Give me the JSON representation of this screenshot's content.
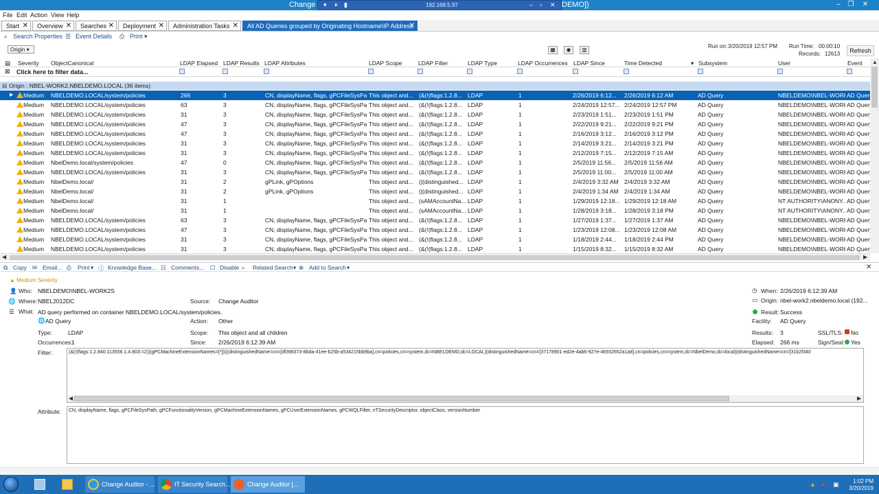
{
  "window": {
    "title": "Change",
    "title_tail": "DEMO])",
    "rdp_ip": "192.168.5.97"
  },
  "menu": [
    "File",
    "Edit",
    "Action",
    "View",
    "Help"
  ],
  "tabs": [
    "Start",
    "Overview",
    "Searches",
    "Deployment",
    "Administration Tasks",
    "All AD Queries grouped by Originating Hostname\\IP Address"
  ],
  "toolbar": {
    "search_properties": "Search Properties",
    "event_details": "Event Details",
    "print": "Print"
  },
  "origin_dropdown": "Origin",
  "run_info": {
    "run_on_label": "Run on:",
    "run_on": "3/20/2019 12:57 PM",
    "run_time_label": "Run Time:",
    "run_time": "00:00:10",
    "records_label": "Records:",
    "records": "12613",
    "refresh": "Refresh"
  },
  "columns": [
    "Severity",
    "ObjectCanonical",
    "LDAP Elapsed",
    "LDAP Results",
    "LDAP Attributes",
    "LDAP Scope",
    "LDAP Filter",
    "LDAP Type",
    "LDAP Occurrences",
    "LDAP Since",
    "Time Detected",
    "Subsystem",
    "User",
    "Event"
  ],
  "filter_row": "Click here to filter data...",
  "group": "Origin : NBEL-WORK2.NBELDEMO.LOCAL (36 items)",
  "rows": [
    [
      "Medium",
      "NBELDEMO.LOCAL/system/policies",
      "266",
      "3",
      "CN, displayName, flags, gPCFileSysPa...",
      "This object and...",
      "(&(!(flags:1.2.8...",
      "LDAP",
      "1",
      "2/26/2019 6:12...",
      "2/26/2019 6:12 AM",
      "AD Query",
      "NBELDEMO\\NBEL-WORK...",
      "AD Query"
    ],
    [
      "Medium",
      "NBELDEMO.LOCAL/system/policies",
      "63",
      "3",
      "CN, displayName, flags, gPCFileSysPa...",
      "This object and...",
      "(&(!(flags:1.2.8...",
      "LDAP",
      "1",
      "2/24/2019 12:57...",
      "2/24/2019 12:57 PM",
      "AD Query",
      "NBELDEMO\\NBEL-WORK...",
      "AD Query"
    ],
    [
      "Medium",
      "NBELDEMO.LOCAL/system/policies",
      "31",
      "3",
      "CN, displayName, flags, gPCFileSysPa...",
      "This object and...",
      "(&(!(flags:1.2.8...",
      "LDAP",
      "1",
      "2/23/2019 1:51...",
      "2/23/2019 1:51 PM",
      "AD Query",
      "NBELDEMO\\NBEL-WORK...",
      "AD Query"
    ],
    [
      "Medium",
      "NBELDEMO.LOCAL/system/policies",
      "47",
      "3",
      "CN, displayName, flags, gPCFileSysPa...",
      "This object and...",
      "(&(!(flags:1.2.8...",
      "LDAP",
      "1",
      "2/22/2019 9:21...",
      "2/22/2019 9:21 PM",
      "AD Query",
      "NBELDEMO\\NBEL-WORK...",
      "AD Query"
    ],
    [
      "Medium",
      "NBELDEMO.LOCAL/system/policies",
      "47",
      "3",
      "CN, displayName, flags, gPCFileSysPa...",
      "This object and...",
      "(&(!(flags:1.2.8...",
      "LDAP",
      "1",
      "2/16/2019 3:12...",
      "2/16/2019 3:12 PM",
      "AD Query",
      "NBELDEMO\\NBEL-WORK...",
      "AD Query"
    ],
    [
      "Medium",
      "NBELDEMO.LOCAL/system/policies",
      "31",
      "3",
      "CN, displayName, flags, gPCFileSysPa...",
      "This object and...",
      "(&(!(flags:1.2.8...",
      "LDAP",
      "1",
      "2/14/2019 3:21...",
      "2/14/2019 3:21 PM",
      "AD Query",
      "NBELDEMO\\NBEL-WORK...",
      "AD Query"
    ],
    [
      "Medium",
      "NBELDEMO.LOCAL/system/policies",
      "31",
      "3",
      "CN, displayName, flags, gPCFileSysPa...",
      "This object and...",
      "(&(!(flags:1.2.8...",
      "LDAP",
      "1",
      "2/12/2019 7:15...",
      "2/12/2019 7:15 AM",
      "AD Query",
      "NBELDEMO\\NBEL-WORK...",
      "AD Query"
    ],
    [
      "Medium",
      "NbelDemo.local/system/policies",
      "47",
      "0",
      "CN, displayName, flags, gPCFileSysPa...",
      "This object and...",
      "(&(!(flags:1.2.8...",
      "LDAP",
      "1",
      "2/5/2019 11:56...",
      "2/5/2019 11:56 AM",
      "AD Query",
      "NBELDEMO\\NBEL-WORK...",
      "AD Query"
    ],
    [
      "Medium",
      "NBELDEMO.LOCAL/system/policies",
      "31",
      "3",
      "CN, displayName, flags, gPCFileSysPa...",
      "This object and...",
      "(&(!(flags:1.2.8...",
      "LDAP",
      "1",
      "2/5/2019 11:00...",
      "2/5/2019 11:00 AM",
      "AD Query",
      "NBELDEMO\\NBEL-WORK...",
      "AD Query"
    ],
    [
      "Medium",
      "NbelDemo.local/",
      "31",
      "2",
      "gPLink, gPOptions",
      "This object and...",
      "(|(distinguished...",
      "LDAP",
      "1",
      "2/4/2019 3:32 AM",
      "2/4/2019 3:32 AM",
      "AD Query",
      "NBELDEMO\\NBEL-WORK...",
      "AD Query"
    ],
    [
      "Medium",
      "NbelDemo.local/",
      "31",
      "2",
      "gPLink, gPOptions",
      "This object and...",
      "(|(distinguished...",
      "LDAP",
      "1",
      "2/4/2019 1:34 AM",
      "2/4/2019 1:34 AM",
      "AD Query",
      "NBELDEMO\\NBEL-WORK...",
      "AD Query"
    ],
    [
      "Medium",
      "NbelDemo.local/",
      "31",
      "1",
      "",
      "This object and...",
      "(sAMAccountNa...",
      "LDAP",
      "1",
      "1/29/2019 12:18...",
      "1/29/2019 12:18 AM",
      "AD Query",
      "NT AUTHORITY\\ANONY...",
      "AD Query"
    ],
    [
      "Medium",
      "NbelDemo.local/",
      "31",
      "1",
      "",
      "This object and...",
      "(sAMAccountNa...",
      "LDAP",
      "1",
      "1/28/2019 3:18...",
      "1/28/2019 3:18 PM",
      "AD Query",
      "NT AUTHORITY\\ANONY...",
      "AD Query"
    ],
    [
      "Medium",
      "NBELDEMO.LOCAL/system/policies",
      "63",
      "3",
      "CN, displayName, flags, gPCFileSysPa...",
      "This object and...",
      "(&(!(flags:1.2.8...",
      "LDAP",
      "1",
      "1/27/2019 1:37...",
      "1/27/2019 1:37 AM",
      "AD Query",
      "NBELDEMO\\NBEL-WORK...",
      "AD Query"
    ],
    [
      "Medium",
      "NBELDEMO.LOCAL/system/policies",
      "47",
      "3",
      "CN, displayName, flags, gPCFileSysPa...",
      "This object and...",
      "(&(!(flags:1.2.8...",
      "LDAP",
      "1",
      "1/23/2019 12:08...",
      "1/23/2019 12:08 AM",
      "AD Query",
      "NBELDEMO\\NBEL-WORK...",
      "AD Query"
    ],
    [
      "Medium",
      "NBELDEMO.LOCAL/system/policies",
      "31",
      "3",
      "CN, displayName, flags, gPCFileSysPa...",
      "This object and...",
      "(&(!(flags:1.2.8...",
      "LDAP",
      "1",
      "1/18/2019 2:44...",
      "1/18/2019 2:44 PM",
      "AD Query",
      "NBELDEMO\\NBEL-WORK...",
      "AD Query"
    ],
    [
      "Medium",
      "NBELDEMO.LOCAL/system/policies",
      "31",
      "3",
      "CN, displayName, flags, gPCFileSysPa...",
      "This object and...",
      "(&(!(flags:1.2.8...",
      "LDAP",
      "1",
      "1/15/2019 8:32...",
      "1/15/2019 8:32 AM",
      "AD Query",
      "NBELDEMO\\NBEL-WORK...",
      "AD Query"
    ]
  ],
  "detail_toolbar": [
    "Copy",
    "Email...",
    "Print",
    "Knowledge Base...",
    "Comments...",
    "Disable",
    "Related Search",
    "Add to Search"
  ],
  "detail": {
    "severity": "Medium Severity",
    "who_label": "Who:",
    "who": "NBELDEMO\\NBEL-WORK2S",
    "where_label": "Where:",
    "where": "NBEL2012DC",
    "source_label": "Source:",
    "source": "Change Auditor",
    "what_label": "What:",
    "what": "AD query performed on container NBELDEMO.LOCAL/system/policies.",
    "what_sub": "AD Query",
    "action_label": "Action:",
    "action": "Other",
    "type_label": "Type:",
    "type": "LDAP",
    "scope_label": "Scope:",
    "scope": "This object and all children",
    "occ_label": "Occurrences:",
    "occ": "1",
    "since_label": "Since:",
    "since": "2/26/2019 6:12:39 AM",
    "filter_label": "Filter:",
    "filter": "(&(!(flags:1.2.840.113556.1.4.803:=2))(gPCMachineExtensionNames=[*])(|(distinguishedName=cn=[df398373-8bda-41ee-b25b-a534215bb9ba],cn=policies,cn=system,dc=NBELDEMO,dc=LOCAL)(distinguishedName=cn=[37178901-ed2e-4ab6-927e-46932652a1a8],cn=policies,cn=system,dc=NbelDemo,dc=local)(distinguishedName=cn=[31b2f340",
    "attr_label": "Attribute:",
    "attr": "CN, displayName, flags, gPCFileSysPath, gPCFunctionalityVersion, gPCMachineExtensionNames, gPCUserExtensionNames, gPCWQLFilter, nTSecurityDescriptor, objectClass, versionNumber",
    "when_label": "When:",
    "when": "2/26/2019 6:12:39 AM",
    "origin_label": "Origin:",
    "origin": "nbel-work2.nbeldemo.local (192...",
    "result_label": "Result:",
    "result": "Success",
    "facility_label": "Facility:",
    "facility": "AD Query",
    "results_label": "Results:",
    "results": "3",
    "ssl_label": "SSL/TLS:",
    "ssl": "No",
    "elapsed_label": "Elapsed:",
    "elapsed": "266 ms",
    "sign_label": "Sign/Seal:",
    "sign": "Yes"
  },
  "taskbar": {
    "items": [
      "Change Auditor - ...",
      "IT Security Search...",
      "Change Auditor [..."
    ],
    "time": "1:02 PM",
    "date": "3/20/2019"
  },
  "colors": {
    "accent": "#1e6cbf",
    "selected_row": "#0a62b5",
    "group_row": "#c6d9f0",
    "warning": "#f0b400"
  }
}
